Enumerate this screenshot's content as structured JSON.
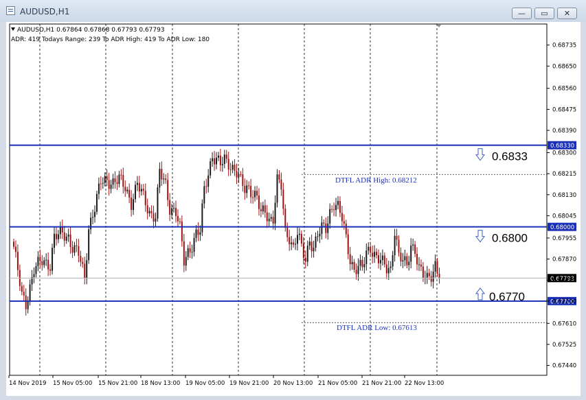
{
  "window": {
    "title": "AUDUSD,H1",
    "buttons": {
      "minimize": "—",
      "maximize": "▭",
      "close": "✕"
    }
  },
  "header": {
    "line1": "AUDUSD,H1  0.67864 0.67868 0.67793 0.67793",
    "line2": "ADR: 419  Todays Range: 239  To ADR High: 419  To ADR Low: 180"
  },
  "colors": {
    "bull": "#1a1a1a",
    "bear": "#a01212",
    "level_line": "#1a2fb8",
    "price_label_bg": "#1a2fb8",
    "adr_text": "#1a2fb8"
  },
  "chart_data": {
    "type": "candlestick",
    "symbol": "AUDUSD",
    "timeframe": "H1",
    "ylim": [
      0.674,
      0.6882
    ],
    "y_ticks": [
      "0.68735",
      "0.68650",
      "0.68560",
      "0.68475",
      "0.68390",
      "0.68300",
      "0.68215",
      "0.68130",
      "0.68045",
      "0.67955",
      "0.67870",
      "0.67785",
      "0.67700",
      "0.67610",
      "0.67525",
      "0.67440"
    ],
    "x_ticks": [
      "14 Nov 2019",
      "15 Nov 05:00",
      "15 Nov 21:00",
      "18 Nov 13:00",
      "19 Nov 05:00",
      "19 Nov 21:00",
      "20 Nov 13:00",
      "21 Nov 05:00",
      "21 Nov 21:00",
      "22 Nov 13:00"
    ],
    "current_price": "0.67793",
    "levels": [
      {
        "value": 0.6833,
        "axis_label": "0.68330",
        "big_label": "0.6833",
        "arrow": "down"
      },
      {
        "value": 0.68,
        "axis_label": "0.68000",
        "big_label": "0.6800",
        "arrow": "down"
      },
      {
        "value": 0.677,
        "axis_label": "0.67700",
        "big_label": "0.6770",
        "arrow": "up"
      }
    ],
    "adr_high": {
      "value": 0.68212,
      "label": "DTFL ADR High: 0.68212"
    },
    "adr_low": {
      "value": 0.67613,
      "label": "DTFL ADR Low: 0.67613"
    },
    "anchors": [
      [
        0,
        0.6792
      ],
      [
        4,
        0.6772
      ],
      [
        6,
        0.6769
      ],
      [
        10,
        0.6783
      ],
      [
        14,
        0.6786
      ],
      [
        18,
        0.6785
      ],
      [
        20,
        0.6796
      ],
      [
        24,
        0.6797
      ],
      [
        27,
        0.6796
      ],
      [
        29,
        0.6792
      ],
      [
        32,
        0.6789
      ],
      [
        35,
        0.6779
      ],
      [
        37,
        0.68
      ],
      [
        40,
        0.6808
      ],
      [
        43,
        0.6818
      ],
      [
        46,
        0.6819
      ],
      [
        49,
        0.6818
      ],
      [
        52,
        0.6819
      ],
      [
        55,
        0.6816
      ],
      [
        58,
        0.681
      ],
      [
        61,
        0.6817
      ],
      [
        64,
        0.6812
      ],
      [
        67,
        0.6806
      ],
      [
        70,
        0.6804
      ],
      [
        72,
        0.6822
      ],
      [
        75,
        0.6817
      ],
      [
        77,
        0.6808
      ],
      [
        80,
        0.6806
      ],
      [
        82,
        0.6799
      ],
      [
        84,
        0.6786
      ],
      [
        86,
        0.679
      ],
      [
        88,
        0.6793
      ],
      [
        90,
        0.6797
      ],
      [
        92,
        0.6798
      ],
      [
        94,
        0.6815
      ],
      [
        96,
        0.6822
      ],
      [
        98,
        0.6829
      ],
      [
        100,
        0.6827
      ],
      [
        102,
        0.6825
      ],
      [
        104,
        0.6827
      ],
      [
        106,
        0.6826
      ],
      [
        108,
        0.6824
      ],
      [
        110,
        0.6822
      ],
      [
        112,
        0.6818
      ],
      [
        114,
        0.6815
      ],
      [
        116,
        0.6816
      ],
      [
        118,
        0.6814
      ],
      [
        120,
        0.6812
      ],
      [
        122,
        0.6805
      ],
      [
        124,
        0.6806
      ],
      [
        126,
        0.6803
      ],
      [
        128,
        0.6804
      ],
      [
        130,
        0.6819
      ],
      [
        132,
        0.6816
      ],
      [
        134,
        0.6797
      ],
      [
        136,
        0.6796
      ],
      [
        138,
        0.6792
      ],
      [
        140,
        0.6798
      ],
      [
        142,
        0.6791
      ],
      [
        144,
        0.6786
      ],
      [
        146,
        0.6795
      ],
      [
        148,
        0.6792
      ],
      [
        150,
        0.6797
      ],
      [
        152,
        0.6799
      ],
      [
        154,
        0.6799
      ],
      [
        156,
        0.6806
      ],
      [
        158,
        0.681
      ],
      [
        160,
        0.6808
      ],
      [
        162,
        0.6803
      ],
      [
        164,
        0.6795
      ],
      [
        166,
        0.6787
      ],
      [
        168,
        0.6783
      ],
      [
        170,
        0.6784
      ],
      [
        172,
        0.6783
      ],
      [
        174,
        0.6789
      ],
      [
        176,
        0.6792
      ],
      [
        178,
        0.6789
      ],
      [
        180,
        0.6787
      ],
      [
        182,
        0.6785
      ],
      [
        184,
        0.6783
      ],
      [
        186,
        0.6783
      ],
      [
        188,
        0.6799
      ],
      [
        190,
        0.6788
      ],
      [
        192,
        0.6786
      ],
      [
        194,
        0.6784
      ],
      [
        196,
        0.6793
      ],
      [
        198,
        0.6791
      ],
      [
        200,
        0.6783
      ],
      [
        202,
        0.678
      ],
      [
        204,
        0.6779
      ],
      [
        206,
        0.6781
      ],
      [
        208,
        0.6785
      ],
      [
        210,
        0.6779
      ]
    ]
  }
}
